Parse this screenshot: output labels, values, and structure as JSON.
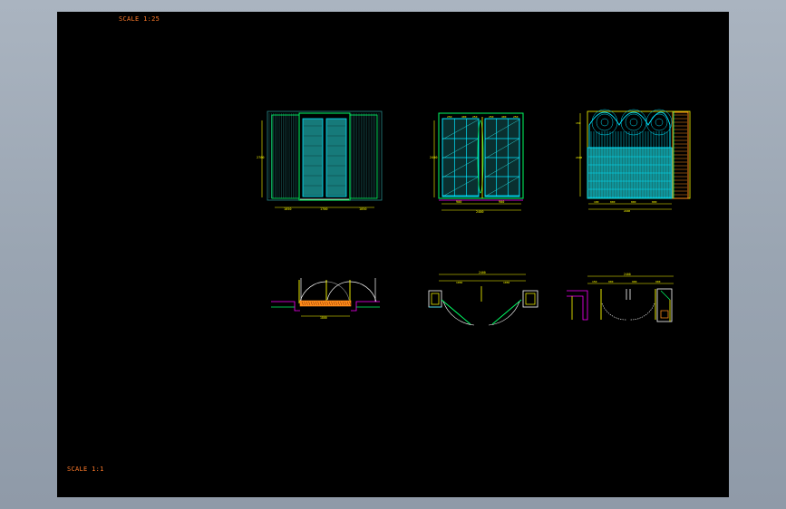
{
  "sheet": {
    "scale_top": "SCALE 1:25",
    "scale_bottom": "SCALE 1:1"
  },
  "colors": {
    "background": "#000000",
    "frame_outer": "#a0aab8",
    "label": "#ff7a2a",
    "dim": "#ffff00",
    "line_green": "#00ff66",
    "line_cyan": "#00e5ff",
    "panel_teal": "#1a8a8a",
    "line_magenta": "#ff00ff",
    "line_white": "#ffffff",
    "line_orange": "#ff8c1a"
  },
  "drawings": [
    {
      "id": "elevation-1",
      "kind": "door elevation, paneled double door"
    },
    {
      "id": "elevation-2",
      "kind": "door elevation, glazed double door"
    },
    {
      "id": "elevation-3",
      "kind": "door elevation, gothic arched grille"
    },
    {
      "id": "plan-1",
      "kind": "door plan"
    },
    {
      "id": "plan-2",
      "kind": "door plan"
    },
    {
      "id": "plan-3",
      "kind": "door plan"
    }
  ]
}
